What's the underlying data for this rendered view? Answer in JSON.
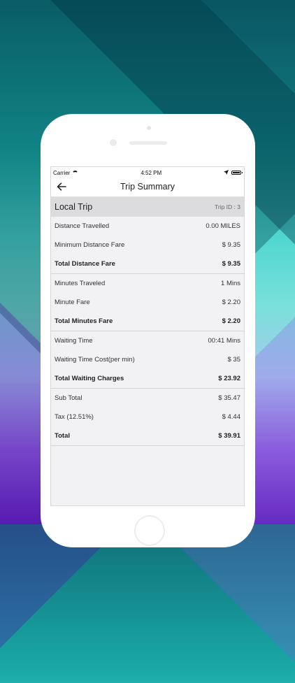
{
  "status_bar": {
    "carrier": "Carrier",
    "time": "4:52 PM"
  },
  "nav": {
    "title": "Trip Summary"
  },
  "trip": {
    "type": "Local Trip",
    "id_text": "Trip ID : 3"
  },
  "groups": [
    {
      "rows": [
        {
          "label": "Distance Travelled",
          "value": "0.00 MILES"
        },
        {
          "label": "Minimum Distance Fare",
          "value": "$ 9.35"
        },
        {
          "label": "Total Distance Fare",
          "value": "$ 9.35"
        }
      ]
    },
    {
      "rows": [
        {
          "label": "Minutes Traveled",
          "value": "1 Mins"
        },
        {
          "label": "Minute Fare",
          "value": "$ 2.20"
        },
        {
          "label": "Total Minutes Fare",
          "value": "$ 2.20"
        }
      ]
    },
    {
      "rows": [
        {
          "label": "Waiting Time",
          "value": "00:41 Mins"
        },
        {
          "label": "Waiting Time Cost(per min)",
          "value": "$ 35"
        },
        {
          "label": "Total Waiting Charges",
          "value": "$ 23.92"
        }
      ]
    },
    {
      "rows": [
        {
          "label": "Sub Total",
          "value": "$ 35.47"
        },
        {
          "label": "Tax (12.51%)",
          "value": "$ 4.44"
        },
        {
          "label": "Total",
          "value": "$ 39.91"
        }
      ]
    }
  ],
  "icons": {
    "back": "arrow-left-icon",
    "wifi": "wifi-icon",
    "location": "location-arrow-icon",
    "battery": "battery-icon"
  }
}
